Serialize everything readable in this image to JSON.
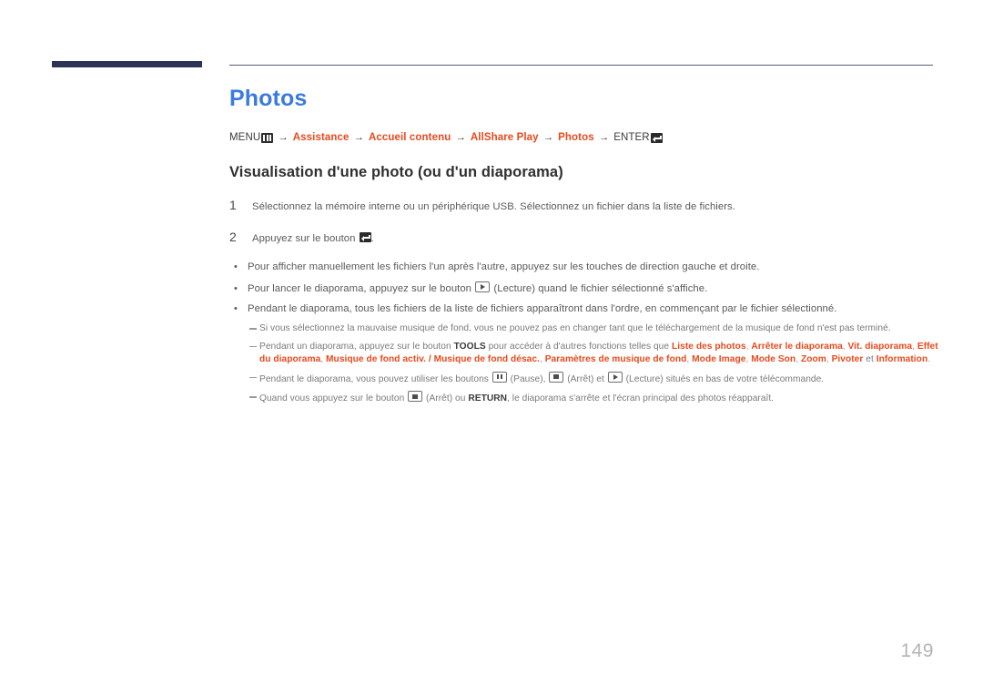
{
  "document": {
    "page_number": "149",
    "title": "Photos",
    "section_heading": "Visualisation d'une photo (ou d'un diaporama)"
  },
  "colors": {
    "title_blue": "#3b7be0",
    "accent_orange": "#e8491c",
    "rule_navy": "#2d3357",
    "body_gray": "#5a5a5a",
    "note_gray": "#7a7a7a",
    "page_number_gray": "#b4b4b4"
  },
  "menu_path": {
    "menu_label": "MENU",
    "menu_icon": "menu-grid-icon",
    "items": [
      "Assistance",
      "Accueil contenu",
      "AllShare Play",
      "Photos"
    ],
    "enter_label": "ENTER",
    "enter_icon": "enter-return-icon",
    "arrow": "→"
  },
  "steps": [
    {
      "number": "1",
      "text": "Sélectionnez la mémoire interne ou un périphérique USB. Sélectionnez un fichier dans la liste de fichiers."
    },
    {
      "number": "2",
      "text_before": "Appuyez sur le bouton",
      "icon": "enter-return-icon",
      "text_after": "."
    }
  ],
  "bullets": [
    {
      "mark": "•",
      "text": "Pour afficher manuellement les fichiers l'un après l'autre, appuyez sur les touches de direction gauche et droite."
    },
    {
      "mark": "•",
      "text_before": "Pour lancer le diaporama, appuyez sur le bouton",
      "icon": "play-key-icon",
      "text_after": "(Lecture) quand le fichier sélectionné s'affiche."
    },
    {
      "mark": "•",
      "text": "Pendant le diaporama, tous les fichiers de la liste de fichiers apparaîtront dans l'ordre, en commençant par le fichier sélectionné."
    }
  ],
  "notes": [
    {
      "text": "Si vous sélectionnez la mauvaise musique de fond, vous ne pouvez pas en changer tant que le téléchargement de la musique de fond n'est pas terminé."
    },
    {
      "text_before": "Pendant un diaporama, appuyez sur le bouton",
      "bold_key": "TOOLS",
      "text_middle": "pour accéder à d'autres fonctions telles que",
      "options": [
        "Liste des photos",
        "Arrêter le diaporama",
        "Vit. diaporama",
        "Effet du diaporama",
        "Musique de fond activ. / Musique de fond désac.",
        "Paramètres de musique de fond",
        "Mode Image",
        "Mode Son",
        "Zoom",
        "Pivoter"
      ],
      "conjunction": "et",
      "last_option": "Information",
      "text_end": "."
    },
    {
      "text_before": "Pendant le diaporama, vous pouvez utiliser les boutons",
      "icon1": "pause-key-icon",
      "label1": "(Pause),",
      "icon2": "stop-key-icon",
      "label2": "(Arrêt) et",
      "icon3": "play-key-icon",
      "label3": "(Lecture) situés en bas de votre télécommande."
    },
    {
      "text_before": "Quand vous appuyez sur le bouton",
      "icon": "stop-key-icon",
      "text_middle": "(Arrêt) ou",
      "bold_key": "RETURN",
      "text_end": ", le diaporama s'arrête et l'écran principal des photos réapparaît."
    }
  ]
}
